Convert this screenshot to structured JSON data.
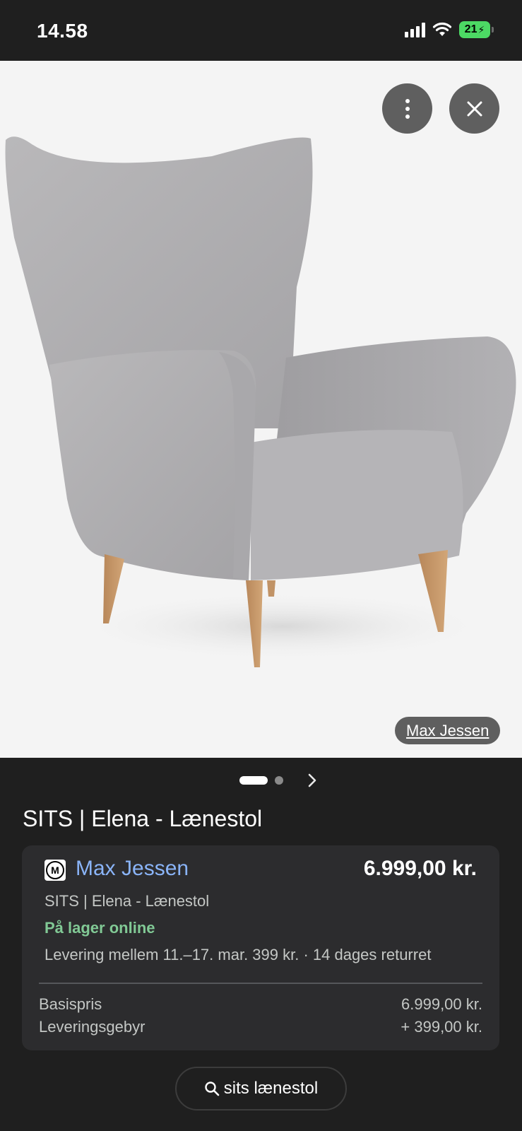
{
  "status_bar": {
    "time": "14.58",
    "battery": "21"
  },
  "viewer": {
    "more_icon": "more-vert-icon",
    "close_icon": "close-icon",
    "source_label": "Max Jessen",
    "carousel": {
      "current": 1,
      "total": 2
    }
  },
  "product": {
    "title": "SITS | Elena - Lænestol"
  },
  "offer": {
    "merchant_name": "Max Jessen",
    "merchant_logo_letter": "M",
    "price": "6.999,00 kr.",
    "subtitle": "SITS | Elena - Lænestol",
    "stock_status": "På lager online",
    "delivery": "Levering mellem 11.–17. mar. 399 kr. · 14 dages returret",
    "rows": [
      {
        "label": "Basispris",
        "value": "6.999,00 kr."
      },
      {
        "label": "Leveringsgebyr",
        "value": "+ 399,00 kr."
      }
    ]
  },
  "search": {
    "label": "sits lænestol",
    "icon": "search-icon"
  },
  "colors": {
    "background": "#1f1f1f",
    "card": "#2c2c2e",
    "link_blue": "#8ab4f8",
    "stock_green": "#81c995",
    "battery_green": "#4cd964"
  }
}
